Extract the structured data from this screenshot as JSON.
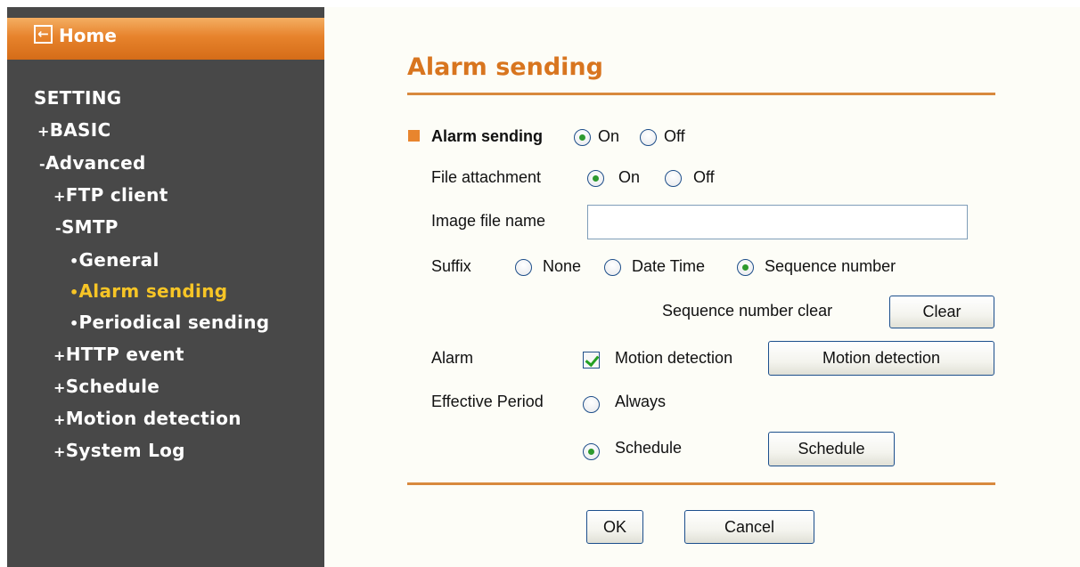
{
  "sidebar": {
    "home_label": "Home",
    "home_icon": "arrow-left-icon",
    "items": [
      {
        "prefix": "",
        "label": "SETTING"
      },
      {
        "prefix": "+",
        "label": "BASIC"
      },
      {
        "prefix": "-",
        "label": "Advanced"
      },
      {
        "prefix": "+",
        "label": "FTP client"
      },
      {
        "prefix": "-",
        "label": "SMTP"
      },
      {
        "prefix": "•",
        "label": "General"
      },
      {
        "prefix": "•",
        "label": "Alarm sending"
      },
      {
        "prefix": "•",
        "label": "Periodical sending"
      },
      {
        "prefix": "+",
        "label": "HTTP event"
      },
      {
        "prefix": "+",
        "label": "Schedule"
      },
      {
        "prefix": "+",
        "label": "Motion detection"
      },
      {
        "prefix": "+",
        "label": "System Log"
      }
    ],
    "active_item": "Alarm sending"
  },
  "main": {
    "title": "Alarm sending",
    "alarm_sending": {
      "label": "Alarm sending",
      "on_label": "On",
      "off_label": "Off",
      "selected": "On"
    },
    "file_attachment": {
      "label": "File attachment",
      "on_label": "On",
      "off_label": "Off",
      "selected": "On"
    },
    "image_file_name": {
      "label": "Image file name",
      "value": ""
    },
    "suffix": {
      "label": "Suffix",
      "options": [
        "None",
        "Date Time",
        "Sequence number"
      ],
      "selected": "Sequence number"
    },
    "sequence_clear": {
      "label": "Sequence number clear",
      "button": "Clear"
    },
    "alarm": {
      "label": "Alarm",
      "checkbox_label": "Motion detection",
      "checked": true,
      "button": "Motion detection"
    },
    "effective_period": {
      "label": "Effective Period",
      "always_label": "Always",
      "schedule_label": "Schedule",
      "selected": "Schedule",
      "button": "Schedule"
    },
    "ok_button": "OK",
    "cancel_button": "Cancel"
  },
  "colors": {
    "accent": "#e8852e",
    "title": "#d8751f",
    "sidebar_bg": "#484848",
    "active_nav": "#f7c526"
  }
}
